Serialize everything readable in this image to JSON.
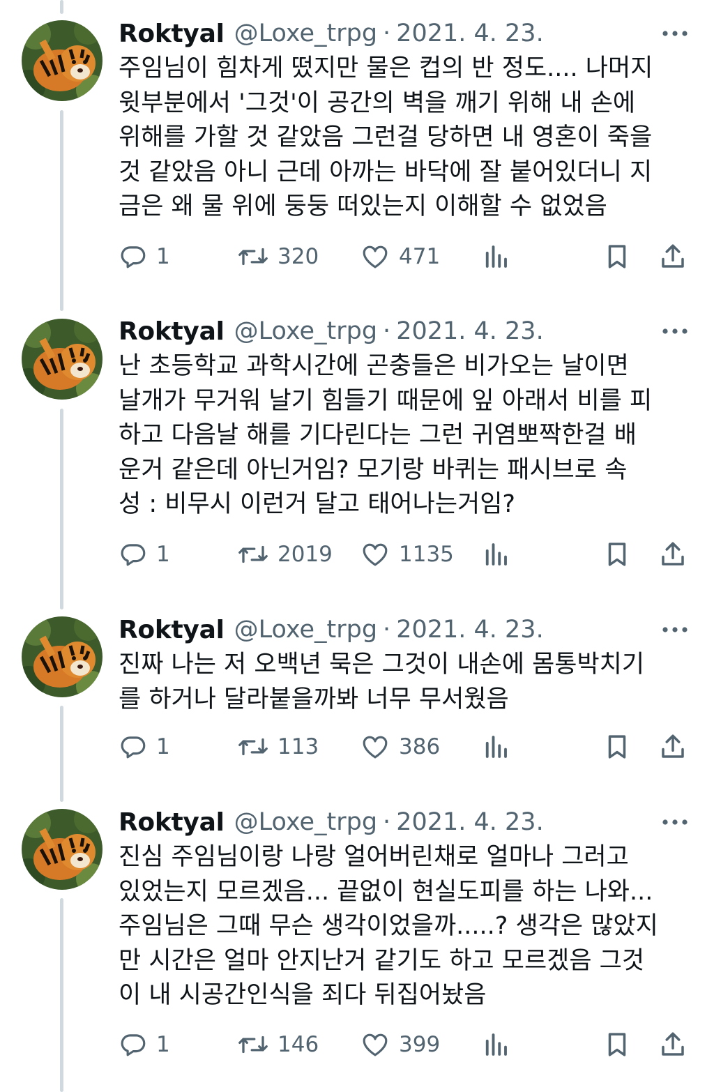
{
  "tweets": [
    {
      "name": "Roktyal",
      "handle": "@Loxe_trpg",
      "separator": "·",
      "date": "2021. 4. 23.",
      "lines": [
        "주임님이 힘차게 떴지만 물은 컵의 반 정도.... 나머지",
        "윗부분에서 '그것'이 공간의 벽을 깨기 위해 내 손에",
        "위해를 가할 것 같았음 그런걸 당하면 내 영혼이 죽을",
        "것 같았음 아니 근데 아까는 바닥에 잘 붙어있더니 지",
        "금은 왜 물 위에 둥둥 떠있는지 이해할 수 없었음"
      ],
      "replies": "1",
      "retweets": "320",
      "likes": "471"
    },
    {
      "name": "Roktyal",
      "handle": "@Loxe_trpg",
      "separator": "·",
      "date": "2021. 4. 23.",
      "lines": [
        "난 초등학교 과학시간에 곤충들은 비가오는 날이면",
        "날개가 무거워 날기 힘들기 때문에 잎 아래서 비를 피",
        "하고 다음날 해를 기다린다는 그런 귀염뽀짝한걸 배",
        "운거 같은데 아닌거임? 모기랑 바퀴는 패시브로 속",
        "성 : 비무시 이런거 달고 태어나는거임?"
      ],
      "replies": "1",
      "retweets": "2019",
      "likes": "1135"
    },
    {
      "name": "Roktyal",
      "handle": "@Loxe_trpg",
      "separator": "·",
      "date": "2021. 4. 23.",
      "lines": [
        "진짜 나는 저 오백년 묵은 그것이 내손에 몸통박치기",
        "를 하거나 달라붙을까봐 너무 무서웠음"
      ],
      "replies": "1",
      "retweets": "113",
      "likes": "386"
    },
    {
      "name": "Roktyal",
      "handle": "@Loxe_trpg",
      "separator": "·",
      "date": "2021. 4. 23.",
      "lines": [
        "진심 주임님이랑 나랑 얼어버린채로 얼마나 그러고",
        "있었는지 모르겠음... 끝없이 현실도피를 하는 나와...",
        "주임님은 그때 무슨 생각이었을까.....? 생각은 많았지",
        "만 시간은 얼마 안지난거 같기도 하고 모르겠음 그것",
        "이 내 시공간인식을 죄다 뒤집어놨음"
      ],
      "replies": "1",
      "retweets": "146",
      "likes": "399"
    }
  ],
  "colors": {
    "text": "#0f1419",
    "secondary": "#536471",
    "thread_line": "#cfd9de"
  },
  "icons": [
    "more-icon",
    "reply-icon",
    "retweet-icon",
    "like-icon",
    "views-icon",
    "bookmark-icon",
    "share-icon"
  ]
}
